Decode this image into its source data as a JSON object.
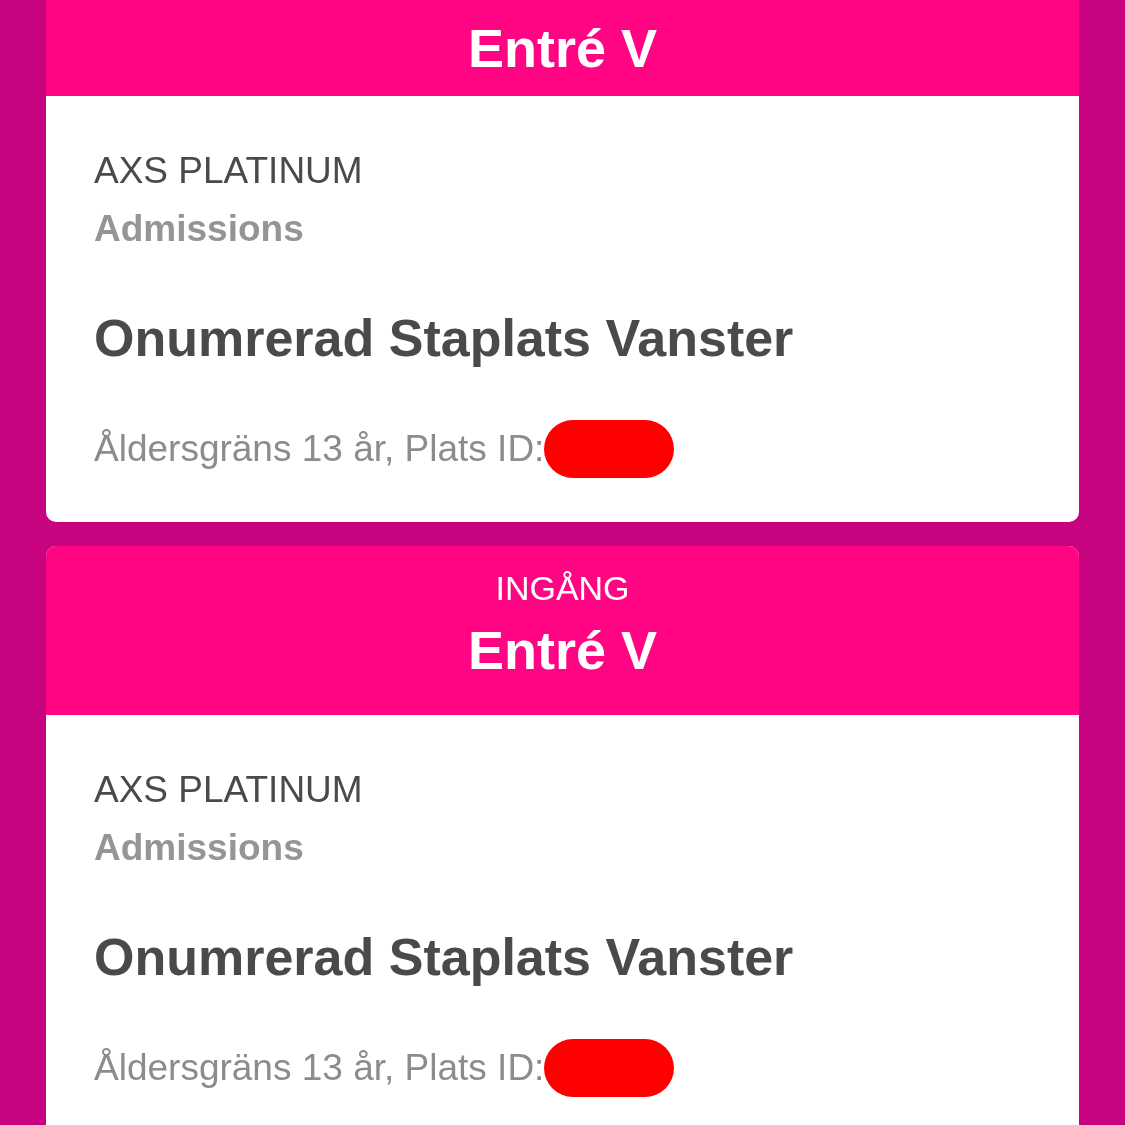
{
  "tickets": [
    {
      "entrance": "Entré V",
      "tier": "AXS PLATINUM",
      "category": "Admissions",
      "section": "Onumrerad Staplats Vanster",
      "details": "Åldersgräns 13 år, Plats ID:"
    },
    {
      "entrance_label": "INGÅNG",
      "entrance": "Entré V",
      "tier": "AXS PLATINUM",
      "category": "Admissions",
      "section": "Onumrerad Staplats Vanster",
      "details": "Åldersgräns 13 år, Plats ID:"
    }
  ]
}
